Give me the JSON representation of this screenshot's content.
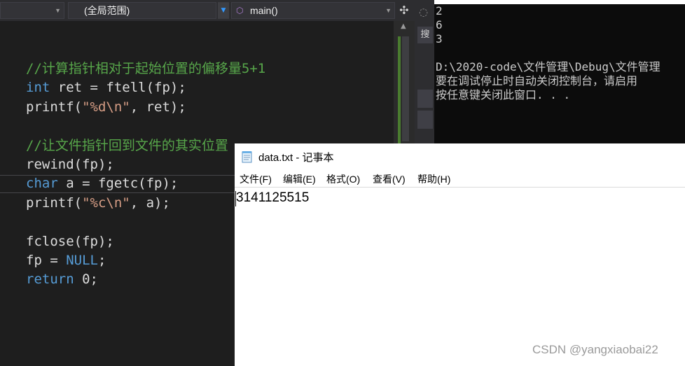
{
  "editor": {
    "nav": {
      "project_combo": "",
      "scope_combo": "(全局范围)",
      "member_combo": "main()"
    },
    "code_lines": [
      [
        {
          "t": "//计算指针相对于起始位置的偏移量5+1",
          "c": "comment"
        }
      ],
      [
        {
          "t": "int",
          "c": "kw"
        },
        {
          "t": " ret = ftell(fp);",
          "c": "plain"
        }
      ],
      [
        {
          "t": "printf(",
          "c": "plain"
        },
        {
          "t": "\"%d\\n\"",
          "c": "str"
        },
        {
          "t": ", ret);",
          "c": "plain"
        }
      ],
      [],
      [
        {
          "t": "//让文件指针回到文件的其实位置",
          "c": "comment"
        }
      ],
      [
        {
          "t": "rewind(fp);",
          "c": "plain"
        }
      ],
      [
        {
          "t": "char",
          "c": "kw"
        },
        {
          "t": " a = fgetc(fp);",
          "c": "plain"
        }
      ],
      [
        {
          "t": "printf(",
          "c": "plain"
        },
        {
          "t": "\"%c\\n\"",
          "c": "str"
        },
        {
          "t": ", a);",
          "c": "plain"
        }
      ],
      [],
      [
        {
          "t": "fclose(fp);",
          "c": "plain"
        }
      ],
      [
        {
          "t": "fp = ",
          "c": "plain"
        },
        {
          "t": "NULL",
          "c": "kw"
        },
        {
          "t": ";",
          "c": "plain"
        }
      ],
      [
        {
          "t": "return",
          "c": "kw"
        },
        {
          "t": " 0;",
          "c": "plain"
        }
      ]
    ],
    "right_panel": {
      "search_tab": "搜"
    }
  },
  "console": {
    "lines": [
      "2",
      "6",
      "3",
      "",
      "D:\\2020-code\\文件管理\\Debug\\文件管理",
      "要在调试停止时自动关闭控制台，请启用",
      "按任意键关闭此窗口. . ."
    ]
  },
  "notepad": {
    "title": "data.txt - 记事本",
    "menu": [
      "文件(F)",
      "编辑(E)",
      "格式(O)",
      "查看(V)",
      "帮助(H)"
    ],
    "content": "3141125515"
  },
  "watermark": "CSDN @yangxiaobai22",
  "colors": {
    "editor_bg": "#1e1e1e",
    "comment": "#57a64a",
    "keyword": "#569cd6",
    "string": "#d69d85",
    "console_bg": "#0c0c0c"
  }
}
